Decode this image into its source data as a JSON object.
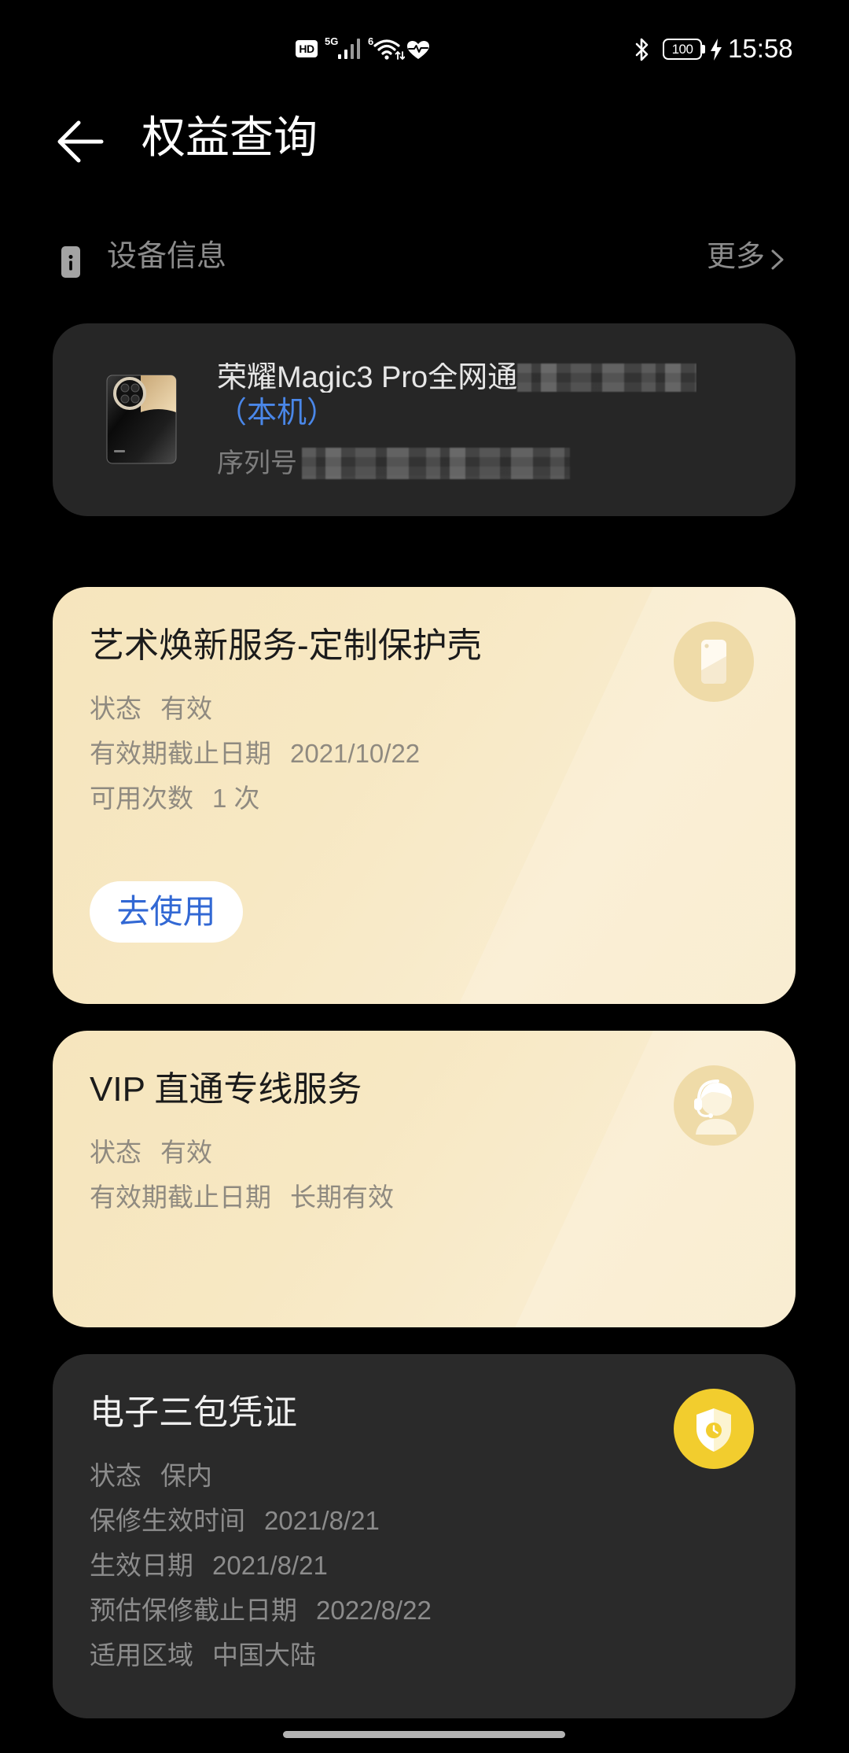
{
  "status_bar": {
    "hd_label": "HD",
    "network_type": "5G",
    "wifi_standard": "6",
    "battery_level": "100",
    "time": "15:58"
  },
  "header": {
    "title": "权益查询"
  },
  "device_section": {
    "title": "设备信息",
    "more_label": "更多"
  },
  "device": {
    "name": "荣耀Magic3 Pro全网通",
    "this_device_label": "（本机）",
    "serial_label": "序列号"
  },
  "benefits": [
    {
      "title": "艺术焕新服务-定制保护壳",
      "icon": "phone-case-icon",
      "rows": [
        {
          "label": "状态",
          "value": "有效"
        },
        {
          "label": "有效期截止日期",
          "value": "2021/10/22"
        },
        {
          "label": "可用次数",
          "value": "1 次"
        }
      ],
      "action_label": "去使用"
    },
    {
      "title": "VIP 直通专线服务",
      "icon": "customer-service-icon",
      "rows": [
        {
          "label": "状态",
          "value": "有效"
        },
        {
          "label": "有效期截止日期",
          "value": "长期有效"
        }
      ]
    },
    {
      "title": "电子三包凭证",
      "icon": "warranty-shield-icon",
      "rows": [
        {
          "label": "状态",
          "value": "保内"
        },
        {
          "label": "保修生效时间",
          "value": "2021/8/21"
        },
        {
          "label": "生效日期",
          "value": "2021/8/21"
        },
        {
          "label": "预估保修截止日期",
          "value": "2022/8/22"
        },
        {
          "label": "适用区域",
          "value": "中国大陆"
        }
      ]
    }
  ],
  "icons": {
    "back": "back-arrow-icon",
    "device_info": "device-info-icon",
    "more": "chevron-right-icon",
    "status": [
      "hd-badge",
      "cellular-signal-icon",
      "wifi-icon",
      "health-icon",
      "bluetooth-icon",
      "battery-icon",
      "charging-icon"
    ]
  },
  "colors": {
    "page_bg": "#000000",
    "device_card_bg": "#262626",
    "benefit_card_bg": "#f7e8c3",
    "benefit_icon_bg": "#efdba8",
    "warranty_card_bg": "#2a2a2a",
    "warranty_icon_bg": "#f2cd2e",
    "this_device_blue": "#4a87e8",
    "action_blue": "#3268d4",
    "muted_text": "#8c8c8c",
    "muted_text_on_cream": "#8f8a80"
  }
}
